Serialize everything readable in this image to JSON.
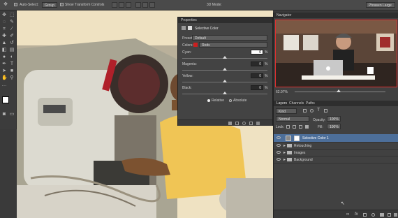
{
  "options_bar": {
    "auto_select_label": "Auto-Select:",
    "auto_select_value": "Group",
    "transform_label": "Show Transform Controls",
    "mode_label": "3D Mode:",
    "workspace": "Phrasen Large"
  },
  "properties": {
    "panel_title": "Properties",
    "adjustment_name": "Selective Color",
    "preset_label": "Preset:",
    "preset_value": "Default",
    "colors_label": "Colors:",
    "colors_value": "Reds",
    "sliders": [
      {
        "label": "Cyan:",
        "value": "0",
        "unit": "%"
      },
      {
        "label": "Magenta:",
        "value": "0",
        "unit": "%"
      },
      {
        "label": "Yellow:",
        "value": "0",
        "unit": "%"
      },
      {
        "label": "Black:",
        "value": "0",
        "unit": "%"
      }
    ],
    "method_relative": "Relative",
    "method_absolute": "Absolute"
  },
  "navigator": {
    "title": "Navigator",
    "zoom": "62.97%"
  },
  "layers": {
    "tabs": [
      "Layers",
      "Channels",
      "Paths"
    ],
    "filter_value": "Kind",
    "blend_mode": "Normal",
    "opacity_label": "Opacity:",
    "opacity_value": "100%",
    "lock_label": "Lock:",
    "fill_label": "Fill:",
    "fill_value": "100%",
    "items": [
      {
        "name": "Selective Color 1",
        "type": "adjustment",
        "selected": true
      },
      {
        "name": "Retouching",
        "type": "group"
      },
      {
        "name": "Images",
        "type": "group"
      },
      {
        "name": "Background",
        "type": "group"
      }
    ]
  },
  "colors": {
    "accent_selected": "#4d6f9a",
    "reds_swatch": "#cc1f1f"
  }
}
